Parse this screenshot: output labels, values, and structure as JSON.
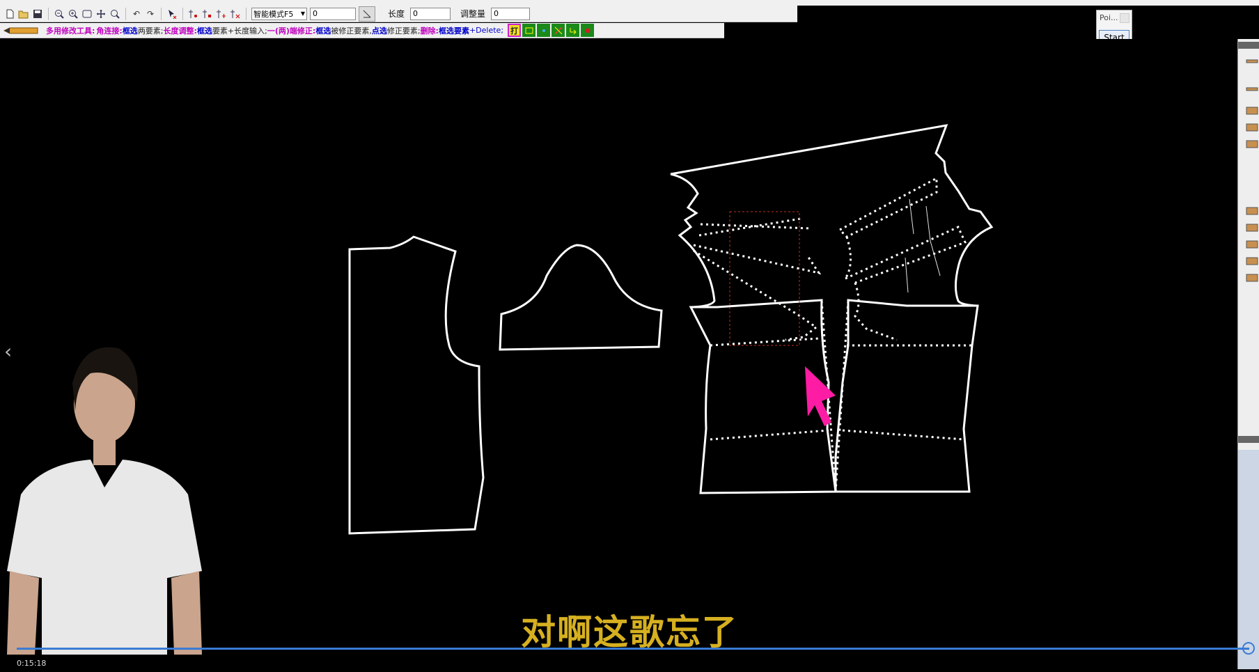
{
  "toolbar": {
    "mode_select": "智能模式F5",
    "value_input": "0",
    "length_label": "长度",
    "length_value": "0",
    "adjust_label": "调整量",
    "adjust_value": "0"
  },
  "hint": {
    "tool_name": "多用修改工具:",
    "corner_label": "角连接:",
    "corner_sel": "框选",
    "corner_text": "两要素;",
    "length_label": "长度调整:",
    "length_sel": "框选",
    "length_text": "要素+长度输入;",
    "end_label": "一(两)端修正:",
    "end_sel": "框选",
    "end_text": "被修正要素,",
    "end_sel2": "点选",
    "end_text2": "修正要素;",
    "delete_label": "删除:",
    "delete_sel": "框选要素",
    "delete_key": "+Delete;",
    "print_label": "打"
  },
  "popup": {
    "title": "Poi...",
    "start_label": "Start"
  },
  "video": {
    "subtitle": "对啊这歌忘了",
    "timestamp": "0:15:18",
    "progress": 1.0
  },
  "colors": {
    "canvas": "#000000",
    "pattern_line": "#ffffff",
    "cursor": "#ff1ca4",
    "subtitle": "#d6b020",
    "progress": "#3a7bd5"
  }
}
